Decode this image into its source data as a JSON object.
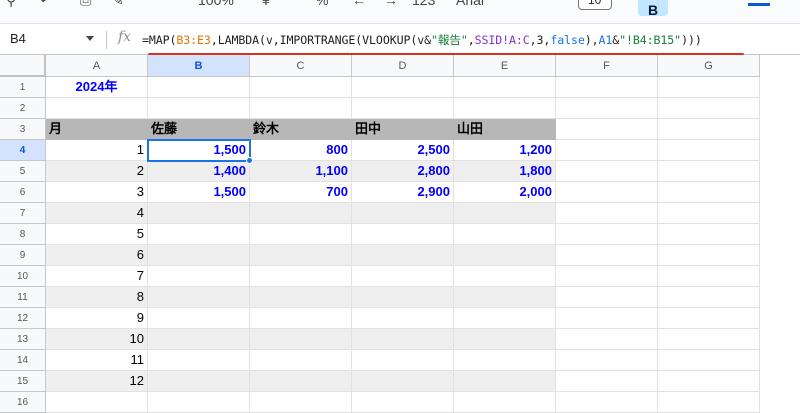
{
  "toolbar": {
    "zoom": "100%",
    "font": "Arial",
    "font_size": "10",
    "bold": "B"
  },
  "formula_bar": {
    "name_box": "B4",
    "fx": "fx",
    "formula_parts": [
      "=MAP(",
      "B3:E3",
      ",LAMBDA(v,IMPORTRANGE(VLOOKUP(v&",
      "\"報告\"",
      ",",
      "SSID!A:C",
      ",3,",
      "false",
      "),",
      "A1",
      "&",
      "\"!B4:B15\"",
      ")))"
    ]
  },
  "columns": [
    "A",
    "B",
    "C",
    "D",
    "E",
    "F",
    "G"
  ],
  "rows": [
    "1",
    "2",
    "3",
    "4",
    "5",
    "6",
    "7",
    "8",
    "9",
    "10",
    "11",
    "12",
    "13",
    "14",
    "15",
    "16"
  ],
  "sheet": {
    "title": "2024年",
    "headers": [
      "月",
      "佐藤",
      "鈴木",
      "田中",
      "山田"
    ],
    "months": [
      "1",
      "2",
      "3",
      "4",
      "5",
      "6",
      "7",
      "8",
      "9",
      "10",
      "11",
      "12"
    ],
    "values": [
      [
        "1,500",
        "800",
        "2,500",
        "1,200"
      ],
      [
        "1,400",
        "1,100",
        "2,800",
        "1,800"
      ],
      [
        "1,500",
        "700",
        "2,900",
        "2,000"
      ]
    ]
  },
  "selection": {
    "cell": "B4"
  },
  "colors": {
    "accent": "#1a73e8",
    "header_fill": "#b7b7b7",
    "band_fill": "#efefef",
    "value_text": "#0000ff",
    "underline": "#d93025"
  }
}
